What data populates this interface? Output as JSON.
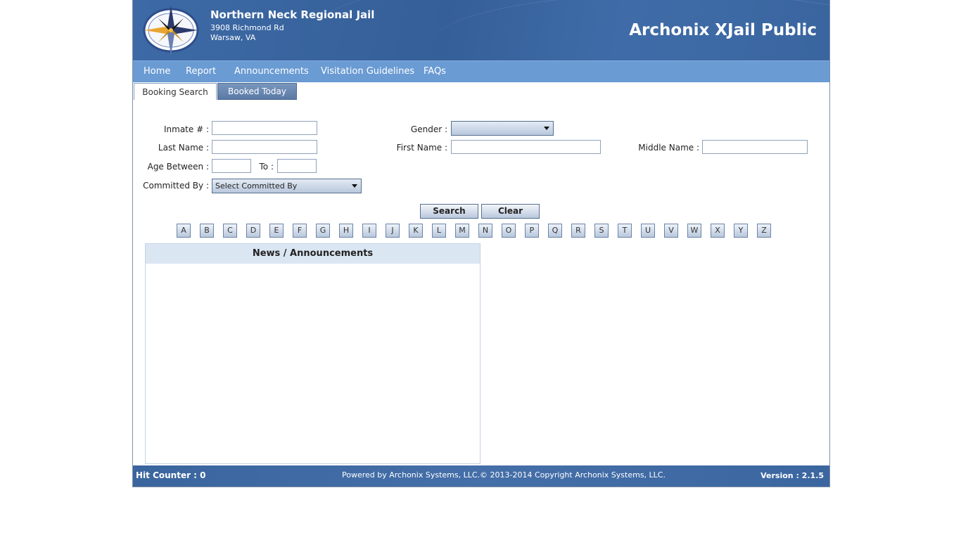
{
  "header": {
    "jail_name": "Northern Neck Regional Jail",
    "address_line1": "3908 Richmond Rd",
    "address_line2": "Warsaw, VA",
    "app_title": "Archonix XJail Public"
  },
  "nav": {
    "items": [
      {
        "label": "Home"
      },
      {
        "label": "Report"
      },
      {
        "label": "Announcements"
      },
      {
        "label": "Visitation Guidelines"
      },
      {
        "label": "FAQs"
      }
    ]
  },
  "tabs": {
    "booking_search": "Booking Search",
    "booked_today": "Booked Today"
  },
  "form": {
    "inmate_label": "Inmate # :",
    "inmate_value": "",
    "gender_label": "Gender :",
    "gender_value": "",
    "last_name_label": "Last Name :",
    "last_name_value": "",
    "first_name_label": "First Name :",
    "first_name_value": "",
    "middle_name_label": "Middle Name :",
    "middle_name_value": "",
    "age_between_label": "Age Between :",
    "age_from_value": "",
    "to_label": "To :",
    "age_to_value": "",
    "committed_by_label": "Committed By :",
    "committed_by_value": "Select Committed By",
    "search_label": "Search",
    "clear_label": "Clear"
  },
  "letters": [
    "A",
    "B",
    "C",
    "D",
    "E",
    "F",
    "G",
    "H",
    "I",
    "J",
    "K",
    "L",
    "M",
    "N",
    "O",
    "P",
    "Q",
    "R",
    "S",
    "T",
    "U",
    "V",
    "W",
    "X",
    "Y",
    "Z"
  ],
  "news": {
    "title": "News / Announcements"
  },
  "footer": {
    "hit_counter": "Hit Counter : 0",
    "powered_by": "Powered by Archonix Systems, LLC.© 2013-2014 Copyright Archonix Systems, LLC.",
    "version": "Version : 2.1.5"
  },
  "colors": {
    "header_blue": "#3d6aa6",
    "nav_blue": "#6a9bd3",
    "news_head_bg": "#dbe6f3"
  }
}
